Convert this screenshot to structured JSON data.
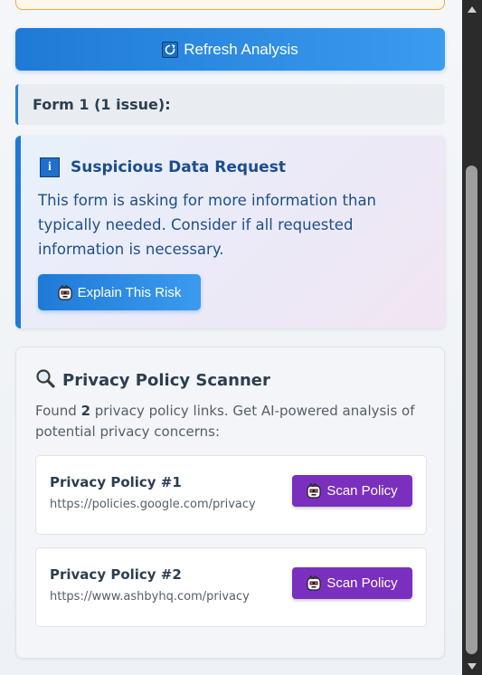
{
  "toolbar": {
    "refresh_label": "Refresh Analysis"
  },
  "form": {
    "header": "Form 1 (1 issue):"
  },
  "risk": {
    "title": "Suspicious Data Request",
    "description": "This form is asking for more information than typically needed. Consider if all requested information is necessary.",
    "explain_label": "Explain This Risk"
  },
  "scanner": {
    "title": "Privacy Policy Scanner",
    "desc_prefix": "Found ",
    "count": "2",
    "desc_suffix": " privacy policy links. Get AI-powered analysis of potential privacy concerns:",
    "policies": [
      {
        "name": "Privacy Policy #1",
        "url": "https://policies.google.com/privacy",
        "button": "Scan Policy"
      },
      {
        "name": "Privacy Policy #2",
        "url": "https://www.ashbyhq.com/privacy",
        "button": "Scan Policy"
      }
    ]
  },
  "icons": {
    "refresh": "refresh-icon",
    "info": "info-icon",
    "robot": "robot-icon",
    "search": "magnifying-glass-icon"
  },
  "colors": {
    "primary_blue": "#1f7ad6",
    "scan_purple": "#7b2fbf",
    "warning_border": "#f3a64a"
  }
}
